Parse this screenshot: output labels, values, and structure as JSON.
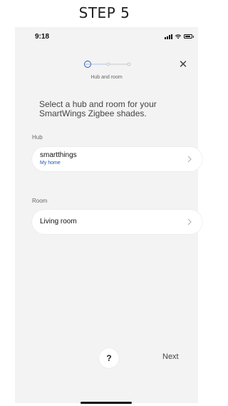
{
  "step_title": "STEP 5",
  "status_bar": {
    "time": "9:18"
  },
  "header": {
    "step_caption": "Hub and room",
    "close_symbol": "✕"
  },
  "heading": "Select a hub and room for your SmartWings Zigbee  shades.",
  "hub": {
    "label": "Hub",
    "name": "smartthings",
    "location": "My home"
  },
  "room": {
    "label": "Room",
    "name": "Living room"
  },
  "footer": {
    "help_symbol": "?",
    "next_label": "Next"
  },
  "colors": {
    "accent": "#1a56b8",
    "background": "#f3f3f3",
    "card": "#ffffff"
  },
  "icons": [
    "signal-icon",
    "wifi-icon",
    "battery-icon",
    "progress-steps-icon",
    "close-icon",
    "chevron-right-icon",
    "help-icon"
  ]
}
